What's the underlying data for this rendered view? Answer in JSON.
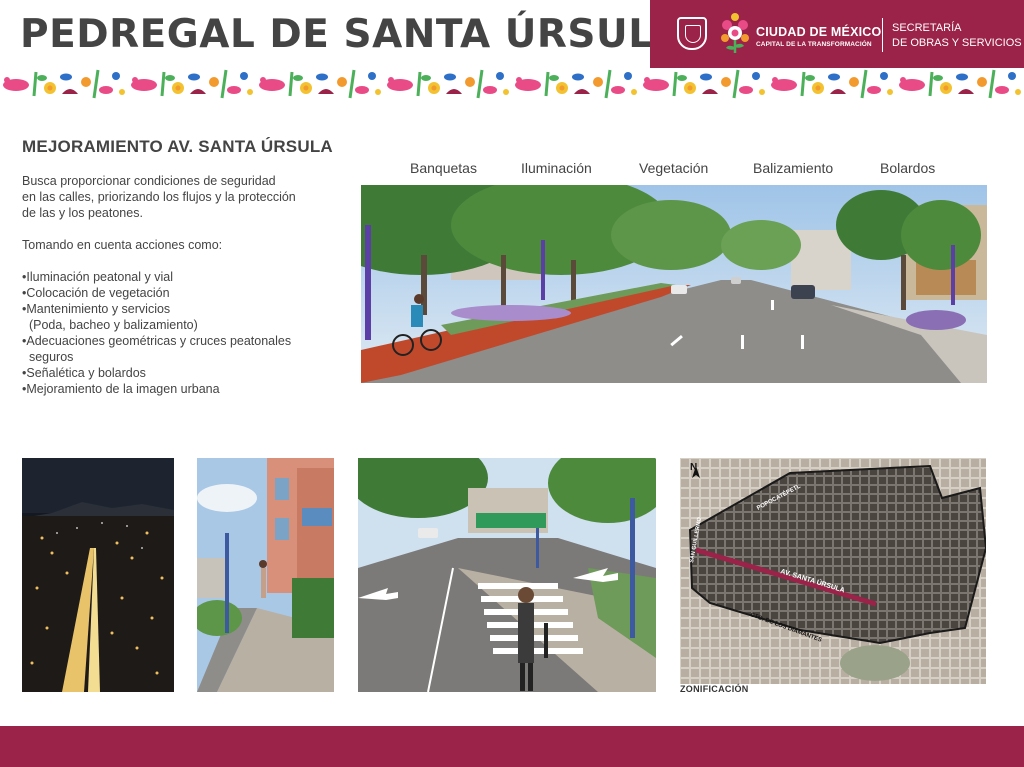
{
  "header": {
    "title": "PEDREGAL DE SANTA ÚRSULA",
    "brand": {
      "city_name": "CIUDAD DE MÉXICO",
      "city_tagline": "CAPITAL DE LA TRANSFORMACIÓN",
      "secretaria_line1": "SECRETARÍA",
      "secretaria_line2": "DE OBRAS Y SERVICIOS",
      "color": "#9b2248"
    }
  },
  "section": {
    "title": "MEJORAMIENTO AV. SANTA ÚRSULA",
    "intro_lines": [
      "Busca proporcionar condiciones de seguridad",
      "en las calles, priorizando los flujos y la protección",
      "de las y los peatones."
    ],
    "actions_intro": "Tomando en cuenta acciones como:",
    "bullets": [
      "•Iluminación peatonal y vial",
      "•Colocación de vegetación",
      "•Mantenimiento y servicios",
      "  (Poda, bacheo y balizamiento)",
      "•Adecuaciones geométricas y cruces peatonales",
      "  seguros",
      "•Señalética y bolardos",
      "•Mejoramiento de la imagen urbana"
    ]
  },
  "categories": [
    "Banquetas",
    "Iluminación",
    "Vegetación",
    "Balizamiento",
    "Bolardos"
  ],
  "map": {
    "north": "N",
    "streets": {
      "popocatepetl": "POPOCATÉPETL",
      "santa_ursula": "AV. SANTA ÚRSULA",
      "diamantes": "CTO. DE LOS DIAMANTES",
      "san_guillermo": "SAN GUILLERMO"
    },
    "caption": "ZONIFICACIÓN"
  },
  "colors": {
    "accent": "#9b2248",
    "text": "#444444"
  }
}
